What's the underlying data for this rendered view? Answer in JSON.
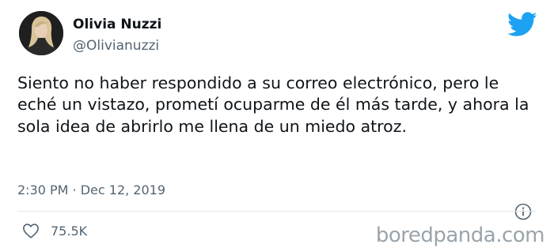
{
  "user": {
    "display_name": "Olivia Nuzzi",
    "handle": "@Olivianuzzi",
    "avatar_icon": "profile-photo"
  },
  "tweet": {
    "text": "Siento no haber respondido a su correo electrónico, pero le eché un vistazo, prometí ocuparme de él más tarde, y ahora la sola idea de abrirlo me llena de un miedo atroz.",
    "timestamp": "2:30 PM · Dec 12, 2019",
    "like_count": "75.5K"
  },
  "icons": {
    "brand": "twitter-bird-icon",
    "info": "info-icon",
    "like": "heart-icon"
  },
  "colors": {
    "brand_blue": "#1da1f2",
    "text_primary": "#0f1419",
    "text_secondary": "#536471"
  },
  "watermark": "boredpanda.com"
}
